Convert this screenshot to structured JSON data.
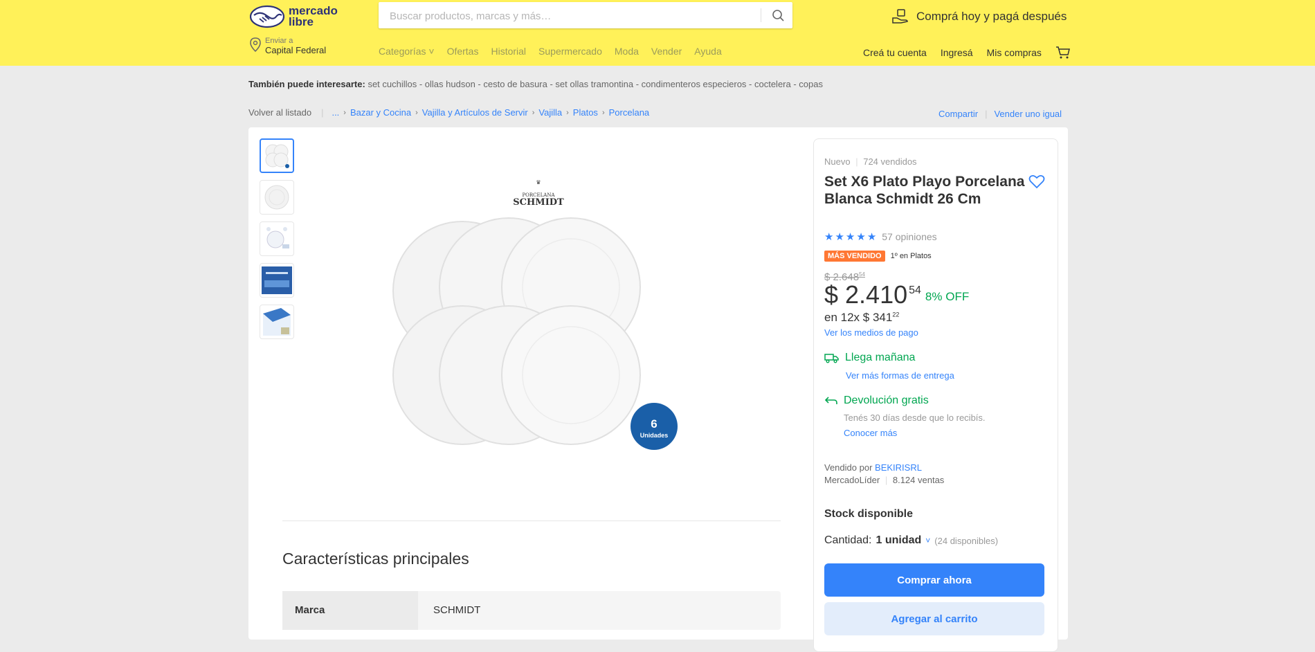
{
  "header": {
    "logo_text": "mercado libre",
    "search_placeholder": "Buscar productos, marcas y más…",
    "promo": "Comprá hoy y pagá después",
    "location_label": "Enviar a",
    "location_value": "Capital Federal",
    "nav": [
      "Categorías",
      "Ofertas",
      "Historial",
      "Supermercado",
      "Moda",
      "Vender",
      "Ayuda"
    ],
    "account": [
      "Creá tu cuenta",
      "Ingresá",
      "Mis compras"
    ]
  },
  "also": {
    "label": "También puede interesarte:",
    "items": "set cuchillos - ollas hudson - cesto de basura - set ollas tramontina - condimenteros especieros - coctelera - copas"
  },
  "breadcrumb": {
    "back": "Volver al listado",
    "items": [
      "...",
      "Bazar y Cocina",
      "Vajilla y Artículos de Servir",
      "Vajilla",
      "Platos",
      "Porcelana"
    ],
    "share": "Compartir",
    "sell": "Vender uno igual"
  },
  "gallery": {
    "brand_logo": "SCHMIDT",
    "brand_sub": "PORCELANA",
    "badge_number": "6",
    "badge_label": "Unidades"
  },
  "specs": {
    "title": "Características principales",
    "rows": [
      {
        "key": "Marca",
        "value": "SCHMIDT"
      }
    ]
  },
  "product": {
    "condition": "Nuevo",
    "sold": "724 vendidos",
    "title": "Set X6 Plato Playo Porcelana Blanca Schmidt 26 Cm",
    "rating": 5,
    "reviews": "57 opiniones",
    "best_seller": "MÁS VENDIDO",
    "rank": "1º en Platos",
    "old_price": "$ 2.648",
    "old_cents": "54",
    "price": "$ 2.410",
    "price_cents": "54",
    "discount": "8% OFF",
    "installments": "en 12x $ 341",
    "installment_cents": "22",
    "payment_link": "Ver los medios de pago",
    "shipping": "Llega mañana",
    "shipping_link": "Ver más formas de entrega",
    "returns": "Devolución gratis",
    "returns_note": "Tenés 30 días desde que lo recibís.",
    "returns_link": "Conocer más",
    "seller_label": "Vendido por",
    "seller_name": "BEKIRISRL",
    "seller_level": "MercadoLíder",
    "seller_sales": "8.124 ventas",
    "stock": "Stock disponible",
    "qty_label": "Cantidad:",
    "qty_value": "1 unidad",
    "qty_avail": "(24 disponibles)",
    "buy_label": "Comprar ahora",
    "cart_label": "Agregar al carrito"
  },
  "colors": {
    "accent": "#3483fa",
    "header": "#fff159",
    "success": "#00a650",
    "badge": "#ff7733"
  }
}
